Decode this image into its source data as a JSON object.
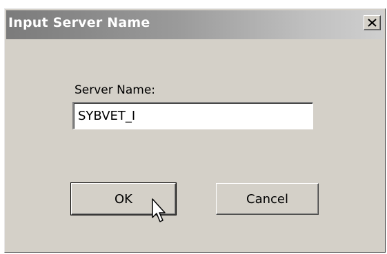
{
  "dialog": {
    "title": "Input Server Name",
    "close_icon": "close-icon",
    "field_label": "Server Name:",
    "server_name_value": "SYBVET_I",
    "ok_label": "OK",
    "cancel_label": "Cancel"
  },
  "cursor": {
    "icon": "mouse-pointer-icon"
  },
  "colors": {
    "dialog_bg": "#d4d0c8",
    "title_gradient_start": "#7b7b7b",
    "title_gradient_end": "#cfcfcf",
    "title_text": "#ffffff"
  }
}
